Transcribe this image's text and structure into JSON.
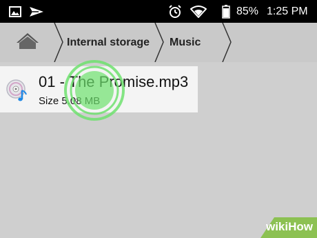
{
  "status_bar": {
    "icons": [
      "image-notification-icon",
      "send-notification-icon",
      "alarm-icon",
      "wifi-icon",
      "battery-icon"
    ],
    "battery_percent": "85%",
    "time": "1:25 PM"
  },
  "breadcrumb": {
    "home_icon": "home-icon",
    "items": [
      "Internal storage",
      "Music"
    ]
  },
  "file_list": {
    "items": [
      {
        "name": "01 - The Promise.mp3",
        "size": "Size 5.08 MB",
        "icon": "music-file-icon"
      }
    ]
  },
  "watermark": {
    "text": "wikiHow"
  },
  "colors": {
    "status_bar": "#000000",
    "breadcrumb_bar": "#c9c9c9",
    "list_background": "#cfcfcf",
    "file_item_background": "#f4f4f4",
    "tap_highlight": "#6ee16e",
    "watermark_green": "#8cc152"
  }
}
